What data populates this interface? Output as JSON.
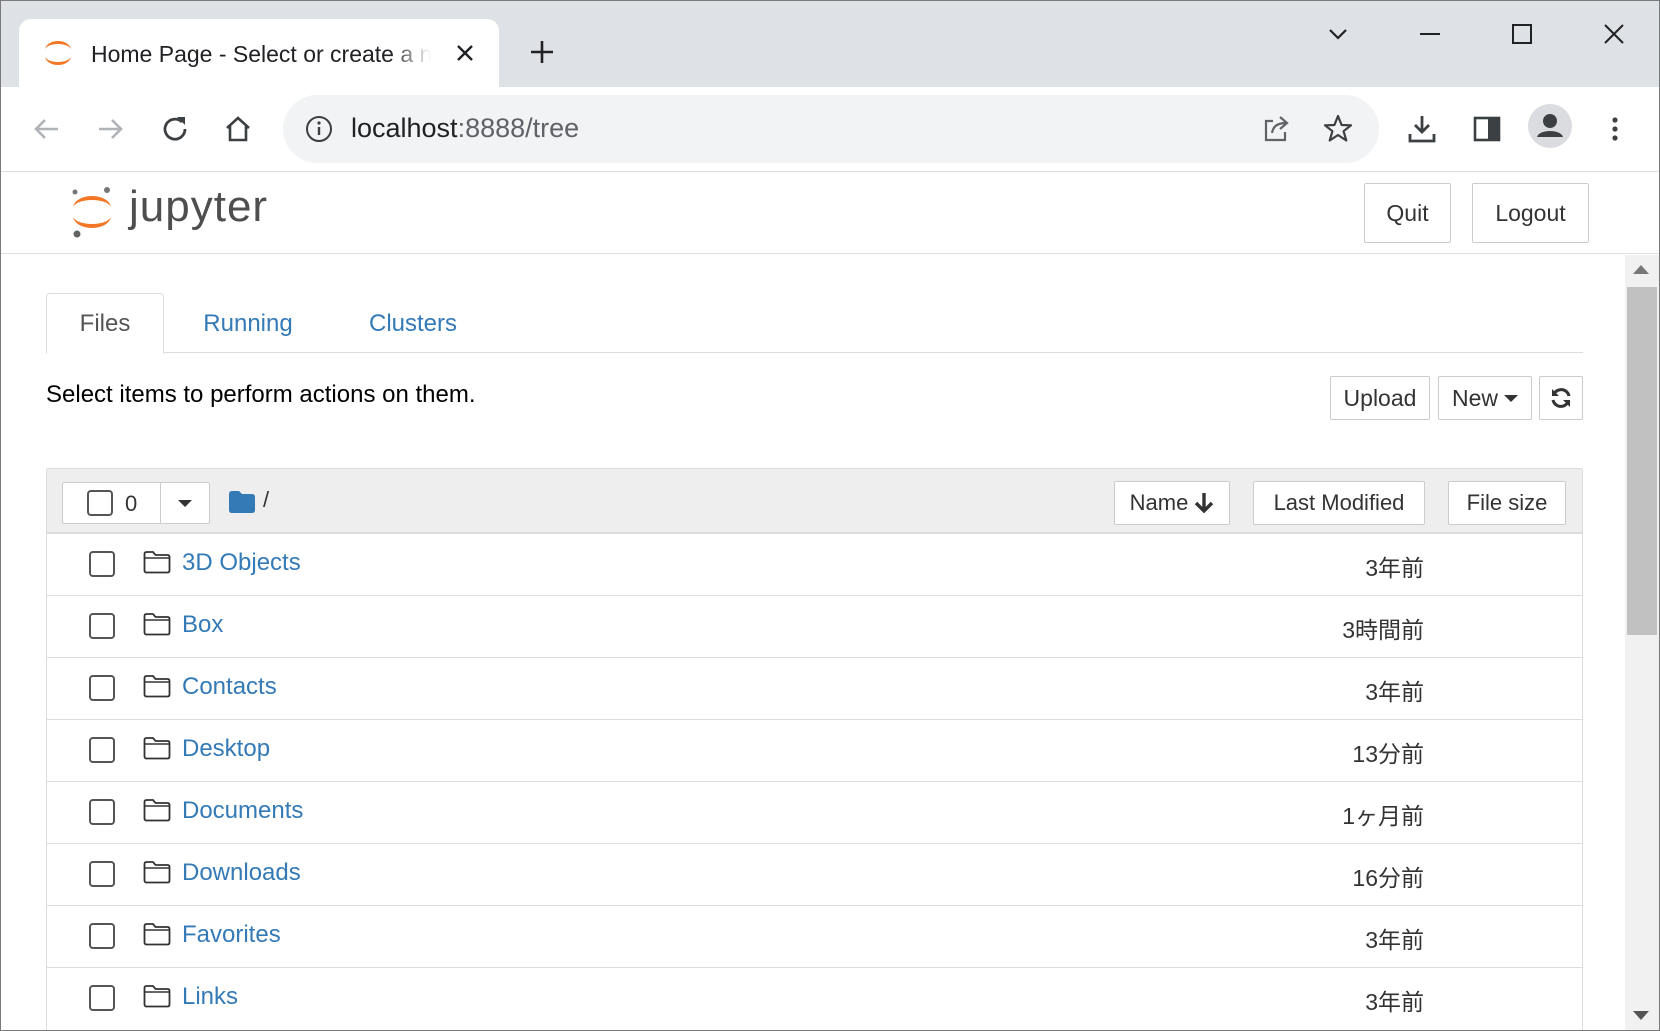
{
  "browser": {
    "tab": {
      "title": "Home Page - Select or create a new notebook",
      "favicon": "jupyter-favicon"
    },
    "omnibox": {
      "host": "localhost",
      "path": ":8888/tree"
    }
  },
  "header": {
    "logo_text": "jupyter",
    "quit_label": "Quit",
    "logout_label": "Logout"
  },
  "tabs": [
    {
      "label": "Files",
      "active": true
    },
    {
      "label": "Running",
      "active": false
    },
    {
      "label": "Clusters",
      "active": false
    }
  ],
  "toolbar": {
    "hint": "Select items to perform actions on them.",
    "upload_label": "Upload",
    "new_label": "New"
  },
  "list": {
    "selected_count": "0",
    "breadcrumb": "/",
    "sort_name_label": "Name",
    "sort_modified_label": "Last Modified",
    "sort_size_label": "File size",
    "items": [
      {
        "name": "3D Objects",
        "modified": "3年前"
      },
      {
        "name": "Box",
        "modified": "3時間前"
      },
      {
        "name": "Contacts",
        "modified": "3年前"
      },
      {
        "name": "Desktop",
        "modified": "13分前"
      },
      {
        "name": "Documents",
        "modified": "1ヶ月前"
      },
      {
        "name": "Downloads",
        "modified": "16分前"
      },
      {
        "name": "Favorites",
        "modified": "3年前"
      },
      {
        "name": "Links",
        "modified": "3年前"
      }
    ]
  },
  "colors": {
    "link": "#337ab7",
    "jupyter_orange": "#f37726",
    "folder_blue": "#337ab7"
  }
}
